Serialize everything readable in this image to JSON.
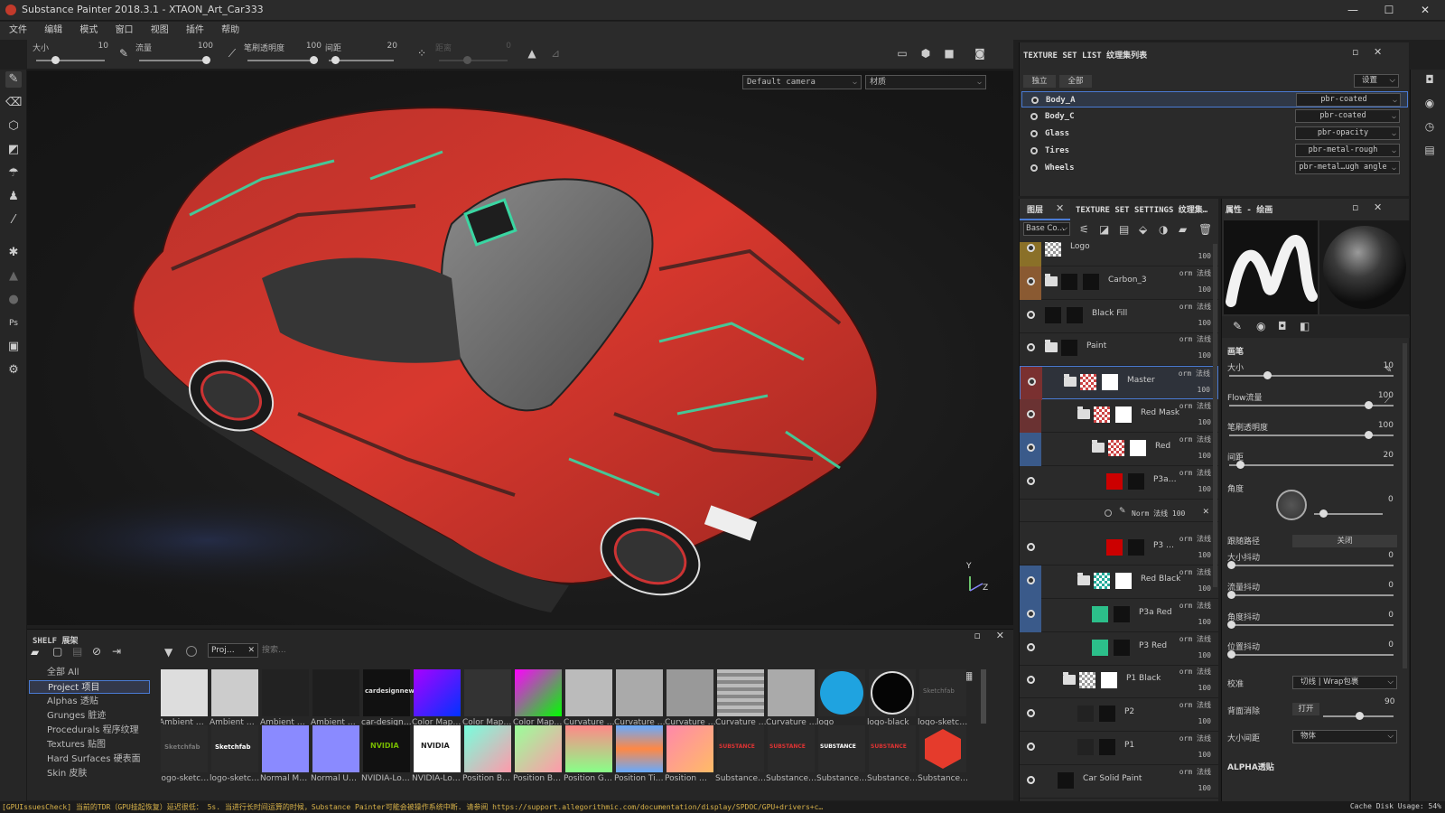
{
  "window": {
    "title": "Substance Painter 2018.3.1 - XTAON_Art_Car333",
    "minimize": "—",
    "maximize": "☐",
    "close": "✕"
  },
  "menu": [
    "文件",
    "编辑",
    "模式",
    "窗口",
    "视图",
    "插件",
    "帮助"
  ],
  "toolbar": {
    "size": {
      "label": "大小",
      "value": "10",
      "level": 0.25
    },
    "flow": {
      "label": "流量",
      "value": "100",
      "level": 1.0
    },
    "opacity": {
      "label": "笔刷透明度",
      "value": "100",
      "level": 0.98
    },
    "spacing": {
      "label": "间距",
      "value": "20",
      "level": 0.05
    },
    "jitter": {
      "label": "距离",
      "value": "0",
      "level": 0.4
    }
  },
  "viewport": {
    "camera_select": "Default camera",
    "channel_select": "材质",
    "axis_y": "Y",
    "axis_z": "Z"
  },
  "texture_set_list": {
    "title": "TEXTURE SET LIST 纹理集列表",
    "tab_solo": "独立",
    "tab_all": "全部",
    "settings": "设置",
    "sets": [
      {
        "name": "Body_A",
        "shader": "pbr-coated"
      },
      {
        "name": "Body_C",
        "shader": "pbr-coated"
      },
      {
        "name": "Glass",
        "shader": "pbr-opacity"
      },
      {
        "name": "Tires",
        "shader": "pbr-metal-rough"
      },
      {
        "name": "Wheels",
        "shader": "pbr-metal…ugh angle"
      }
    ]
  },
  "layers_panel": {
    "tab_layers": "图层",
    "tab_tss": "TEXTURE SET SETTINGS 纹理集…",
    "channel": "Base Co…",
    "rows": [
      {
        "name": "Logo",
        "blend": "",
        "opacity": "100"
      },
      {
        "name": "Carbon_3",
        "blend": "orm 法线",
        "opacity": "100"
      },
      {
        "name": "Black Fill",
        "blend": "orm 法线",
        "opacity": "100"
      },
      {
        "name": "Paint",
        "blend": "orm 法线",
        "opacity": "100"
      },
      {
        "name": "Master",
        "blend": "orm 法线",
        "opacity": "100"
      },
      {
        "name": "Red Mask",
        "blend": "orm 法线",
        "opacity": "100"
      },
      {
        "name": "Red",
        "blend": "orm 法线",
        "opacity": "100"
      },
      {
        "name": "P3a…",
        "blend": "orm 法线",
        "opacity": "100"
      },
      {
        "name": "Norm 法线 100",
        "blend": "",
        "opacity": ""
      },
      {
        "name": "P3 …",
        "blend": "orm 法线",
        "opacity": "100"
      },
      {
        "name": "Red Black",
        "blend": "orm 法线",
        "opacity": "100"
      },
      {
        "name": "P3a Red",
        "blend": "orm 法线",
        "opacity": "100"
      },
      {
        "name": "P3 Red",
        "blend": "orm 法线",
        "opacity": "100"
      },
      {
        "name": "P1 Black",
        "blend": "orm 法线",
        "opacity": "100"
      },
      {
        "name": "P2",
        "blend": "orm 法线",
        "opacity": "100"
      },
      {
        "name": "P1",
        "blend": "orm 法线",
        "opacity": "100"
      },
      {
        "name": "Car Solid Paint",
        "blend": "orm 法线",
        "opacity": "100"
      }
    ]
  },
  "properties": {
    "title": "属性 - 绘画",
    "section_brush": "画笔",
    "params": [
      {
        "label": "大小",
        "value": "10",
        "level": 0.25
      },
      {
        "label": "Flow流量",
        "value": "100",
        "level": 1.0
      },
      {
        "label": "笔刷透明度",
        "value": "100",
        "level": 1.0
      },
      {
        "label": "间距",
        "value": "20",
        "level": 0.05
      }
    ],
    "angle_label": "角度",
    "angle_value": "0",
    "follow_path_label": "跟随路径",
    "follow_path_value": "关闭",
    "jitters": [
      {
        "label": "大小抖动",
        "value": "0"
      },
      {
        "label": "流量抖动",
        "value": "0"
      },
      {
        "label": "角度抖动",
        "value": "0"
      },
      {
        "label": "位置抖动",
        "value": "0"
      }
    ],
    "align_label": "校准",
    "align_value": "切线",
    "align_wrap": "Wrap包裹",
    "backface_label": "背面消除",
    "backface_value": "打开",
    "backface_num": "90",
    "size_space_label": "大小间距",
    "size_space_value": "物体",
    "alpha_section": "ALPHA透贴"
  },
  "shelf": {
    "title": "SHELF 展架",
    "filter_tag": "Proj…",
    "search_placeholder": "搜索...",
    "categories": [
      "全部 All",
      "Project 项目",
      "Alphas 透贴",
      "Grunges 脏迹",
      "Procedurals 程序纹理",
      "Textures 贴图",
      "Hard Surfaces 硬表面",
      "Skin 皮肤"
    ],
    "selected_category": "Project 项目",
    "row1": [
      "Ambient …",
      "Ambient …",
      "Ambient …",
      "Ambient …",
      "car-design…",
      "Color Map…",
      "Color Map…",
      "Color Map…",
      "Curvature …",
      "Curvature …",
      "Curvature …",
      "Curvature …",
      "Curvature …",
      "logo",
      "logo-black",
      "logo-sketc…"
    ],
    "row2": [
      "logo-sketc…",
      "logo-sketc…",
      "Normal M…",
      "Normal U…",
      "NVIDIA-Lo…",
      "NVIDIA-Lo…",
      "Position B…",
      "Position B…",
      "Position G…",
      "Position Ti…",
      "Position …",
      "Substance…",
      "Substance…",
      "Substance…",
      "Substance…",
      "Substance…"
    ],
    "thumb_texts": {
      "cardesign": "cardesignnews",
      "sketchfab": "Sketchfab",
      "nvidia": "NVIDIA",
      "substance": "SUBSTANCE"
    }
  },
  "status": {
    "message": "[GPUIssuesCheck] 当前的TDR（GPU挂起恢复）延迟很低： 5s. 当进行长时间运算的时候，Substance Painter可能会被操作系统中断. 请参阅 https://support.allegorithmic.com/documentation/display/SPDOC/GPU+drivers+c…",
    "cache_label": "Cache Disk Usage:",
    "cache_value": "54%"
  },
  "colors": {
    "accent": "#4a7bd4",
    "red_paint": "#d8382e",
    "teal": "#3ad6a2",
    "status_warn": "#d9b34a"
  }
}
